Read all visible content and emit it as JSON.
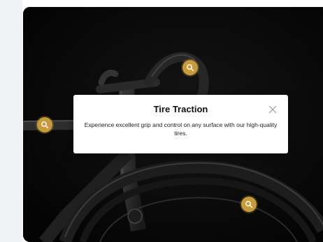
{
  "popover": {
    "title": "Tire Traction",
    "description": "Experience excellent grip and control on any surface with our high-quality tires.",
    "close_icon": "close-icon"
  },
  "hotspots": [
    {
      "name": "hotspot-handlebar",
      "icon": "search-icon"
    },
    {
      "name": "hotspot-frame",
      "icon": "search-icon"
    },
    {
      "name": "hotspot-tire",
      "icon": "search-icon"
    }
  ],
  "colors": {
    "hotspot": "#c79a3c",
    "card_background": "#050505",
    "popover_background": "#ffffff"
  }
}
